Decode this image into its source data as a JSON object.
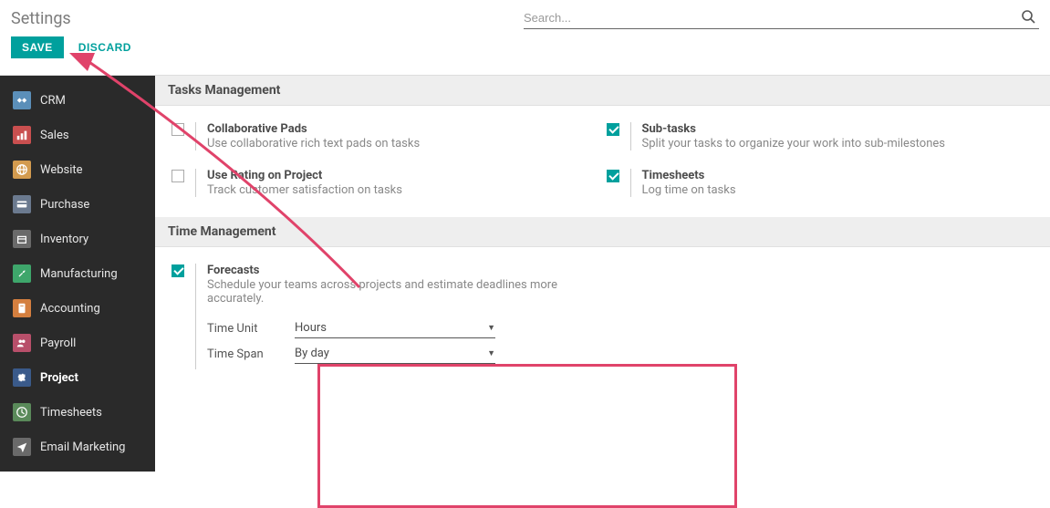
{
  "header": {
    "title": "Settings",
    "search_placeholder": "Search...",
    "save_label": "SAVE",
    "discard_label": "DISCARD"
  },
  "sidebar": {
    "items": [
      {
        "label": "CRM",
        "icon_bg": "#5b8fb9",
        "active": false
      },
      {
        "label": "Sales",
        "icon_bg": "#c94f4f",
        "active": false
      },
      {
        "label": "Website",
        "icon_bg": "#d39b4f",
        "active": false
      },
      {
        "label": "Purchase",
        "icon_bg": "#6b7a8f",
        "active": false
      },
      {
        "label": "Inventory",
        "icon_bg": "#6a6a6a",
        "active": false
      },
      {
        "label": "Manufacturing",
        "icon_bg": "#3ea66b",
        "active": false
      },
      {
        "label": "Accounting",
        "icon_bg": "#d47f3f",
        "active": false
      },
      {
        "label": "Payroll",
        "icon_bg": "#b84f6a",
        "active": false
      },
      {
        "label": "Project",
        "icon_bg": "#3a5a8a",
        "active": true
      },
      {
        "label": "Timesheets",
        "icon_bg": "#5a8a5a",
        "active": false
      },
      {
        "label": "Email Marketing",
        "icon_bg": "#6a6a6a",
        "active": false
      }
    ]
  },
  "sections": [
    {
      "title": "Tasks Management",
      "options": [
        {
          "title": "Collaborative Pads",
          "desc": "Use collaborative rich text pads on tasks",
          "checked": false
        },
        {
          "title": "Sub-tasks",
          "desc": "Split your tasks to organize your work into sub-milestones",
          "checked": true
        },
        {
          "title": "Use Rating on Project",
          "desc": "Track customer satisfaction on tasks",
          "checked": false
        },
        {
          "title": "Timesheets",
          "desc": "Log time on tasks",
          "checked": true
        }
      ]
    },
    {
      "title": "Time Management",
      "options": [
        {
          "title": "Forecasts",
          "desc": "Schedule your teams across projects and estimate deadlines more accurately.",
          "checked": true,
          "sub": [
            {
              "label": "Time Unit",
              "value": "Hours"
            },
            {
              "label": "Time Span",
              "value": "By day"
            }
          ]
        }
      ]
    }
  ],
  "colors": {
    "accent": "#00a09d",
    "highlight": "#e0436a"
  }
}
